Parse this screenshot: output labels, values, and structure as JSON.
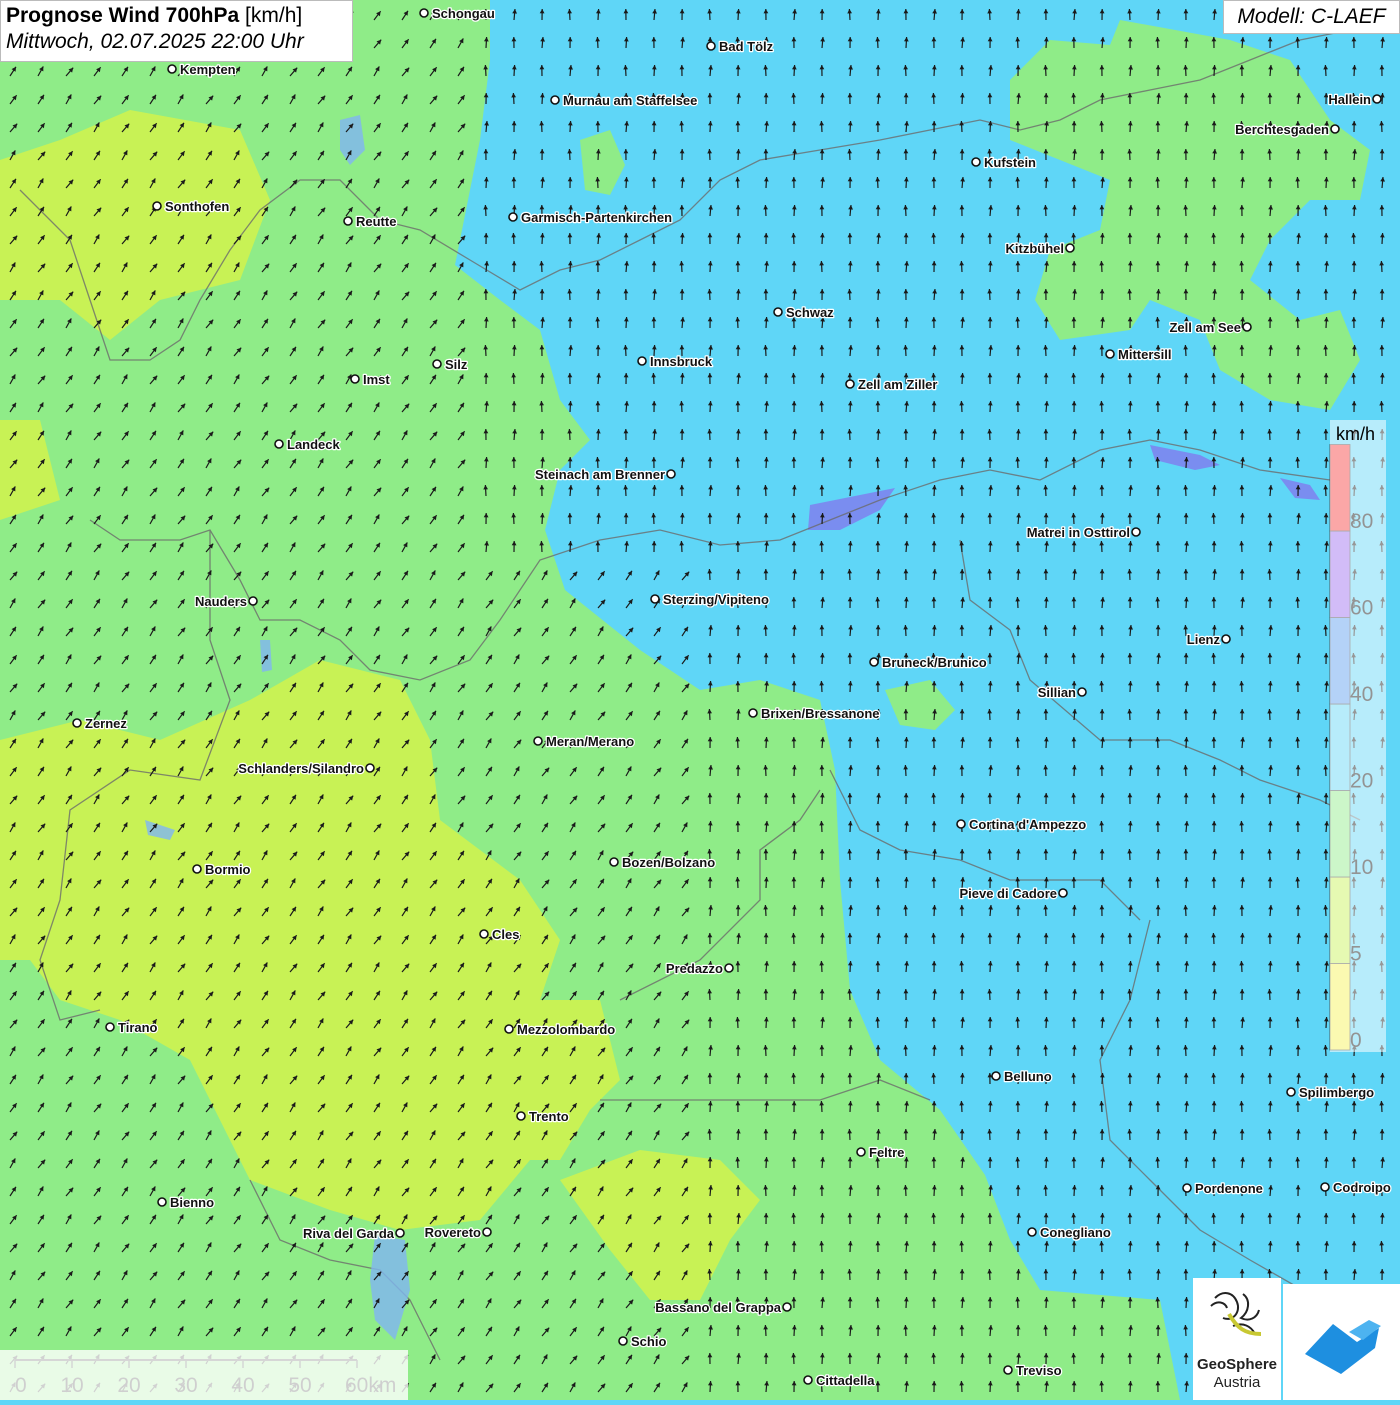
{
  "header": {
    "title_bold": "Prognose Wind 700hPa",
    "title_unit": "[km/h]",
    "datetime": "Mittwoch, 02.07.2025 22:00 Uhr",
    "model": "Modell: C-LAEF"
  },
  "legend": {
    "unit": "km/h",
    "bands": [
      {
        "label": "0",
        "color": "#f7f252"
      },
      {
        "label": "5",
        "color": "#c8f255"
      },
      {
        "label": "10",
        "color": "#8fec88"
      },
      {
        "label": "20",
        "color": "#5fd6f7"
      },
      {
        "label": "40",
        "color": "#5a9cf0"
      },
      {
        "label": "60",
        "color": "#9b6af0"
      },
      {
        "label": "80",
        "color": "#f53c3c"
      }
    ]
  },
  "scale_bar": {
    "labels": [
      "0",
      "10",
      "20",
      "30",
      "40",
      "50",
      "60km"
    ]
  },
  "cities": [
    {
      "name": "Schongau"
    },
    {
      "name": "Bad Tölz"
    },
    {
      "name": "Kempten"
    },
    {
      "name": "Murnau am Staffelsee"
    },
    {
      "name": "Hallein"
    },
    {
      "name": "Berchtesgaden"
    },
    {
      "name": "Kufstein"
    },
    {
      "name": "Sonthofen"
    },
    {
      "name": "Reutte"
    },
    {
      "name": "Garmisch-Partenkirchen"
    },
    {
      "name": "Kitzbühel"
    },
    {
      "name": "Schwaz"
    },
    {
      "name": "Zell am See"
    },
    {
      "name": "Innsbruck"
    },
    {
      "name": "Mittersill"
    },
    {
      "name": "Silz"
    },
    {
      "name": "Imst"
    },
    {
      "name": "Zell am Ziller"
    },
    {
      "name": "Landeck"
    },
    {
      "name": "Steinach am Brenner"
    },
    {
      "name": "Matrei in Osttirol"
    },
    {
      "name": "Nauders"
    },
    {
      "name": "Sterzing/Vipiteno"
    },
    {
      "name": "Lienz"
    },
    {
      "name": "Bruneck/Brunico"
    },
    {
      "name": "Sillian"
    },
    {
      "name": "Zernez"
    },
    {
      "name": "Brixen/Bressanone"
    },
    {
      "name": "Meran/Merano"
    },
    {
      "name": "Schlanders/Silandro"
    },
    {
      "name": "Cortina d'Ampezzo"
    },
    {
      "name": "Bozen/Bolzano"
    },
    {
      "name": "Bormio"
    },
    {
      "name": "Pieve di Cadore"
    },
    {
      "name": "Cles"
    },
    {
      "name": "Predazzo"
    },
    {
      "name": "Tirano"
    },
    {
      "name": "Mezzolombardo"
    },
    {
      "name": "Belluno"
    },
    {
      "name": "Spilimbergo"
    },
    {
      "name": "Trento"
    },
    {
      "name": "Feltre"
    },
    {
      "name": "Pordenone"
    },
    {
      "name": "Codroipo"
    },
    {
      "name": "Bienno"
    },
    {
      "name": "Riva del Garda"
    },
    {
      "name": "Rovereto"
    },
    {
      "name": "Conegliano"
    },
    {
      "name": "Bassano del Grappa"
    },
    {
      "name": "Schio"
    },
    {
      "name": "Treviso"
    },
    {
      "name": "Cittadella"
    }
  ],
  "logos": {
    "geosphere_line1": "GeoSphere",
    "geosphere_line2": "Austria"
  },
  "icons": [
    "geosphere-logo-icon",
    "app-logo-icon"
  ]
}
